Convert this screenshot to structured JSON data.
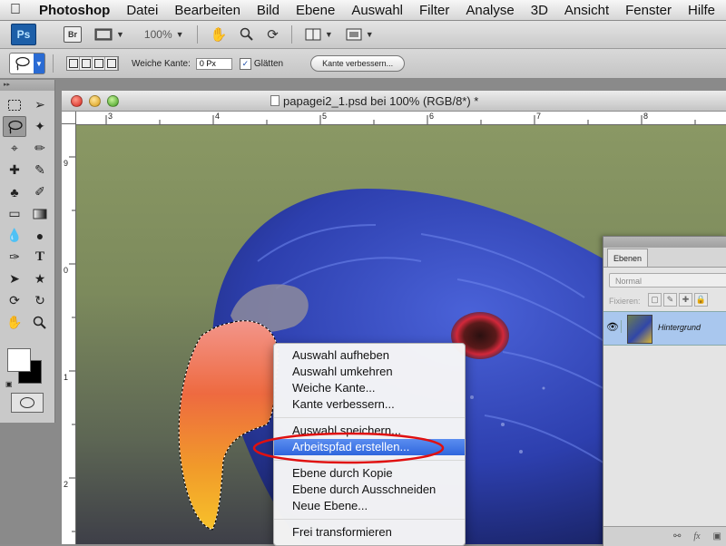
{
  "menubar": {
    "apple_icon": "apple-logo",
    "items": [
      "Photoshop",
      "Datei",
      "Bearbeiten",
      "Bild",
      "Ebene",
      "Auswahl",
      "Filter",
      "Analyse",
      "3D",
      "Ansicht",
      "Fenster",
      "Hilfe"
    ]
  },
  "appbar": {
    "ps_logo": "Ps",
    "br_logo": "Br",
    "zoom": "100%"
  },
  "options": {
    "feather_label": "Weiche Kante:",
    "feather_value": "0 Px",
    "antialias_label": "Glätten",
    "antialias_checked": true,
    "refine_button": "Kante verbessern..."
  },
  "document": {
    "title": "papagei2_1.psd bei 100% (RGB/8*) *",
    "hruler_labels": [
      "3",
      "4",
      "5",
      "6",
      "7",
      "8"
    ],
    "vruler_labels": [
      "9",
      "0",
      "1",
      "1",
      "2"
    ]
  },
  "context_menu": {
    "group1": [
      "Auswahl aufheben",
      "Auswahl umkehren",
      "Weiche Kante...",
      "Kante verbessern..."
    ],
    "group2": [
      "Auswahl speichern...",
      "Arbeitspfad erstellen..."
    ],
    "group3": [
      "Ebene durch Kopie",
      "Ebene durch Ausschneiden",
      "Neue Ebene..."
    ],
    "group4": [
      "Frei transformieren"
    ],
    "highlighted": "Arbeitspfad erstellen...",
    "annotation_color": "#e01010"
  },
  "layers_panel": {
    "tab": "Ebenen",
    "blend_mode": "Normal",
    "lock_label": "Fixieren:",
    "layer_name": "Hintergrund"
  },
  "colors": {
    "accent_blue": "#2f66dd",
    "foreground": "#ffffff",
    "background": "#000000"
  }
}
